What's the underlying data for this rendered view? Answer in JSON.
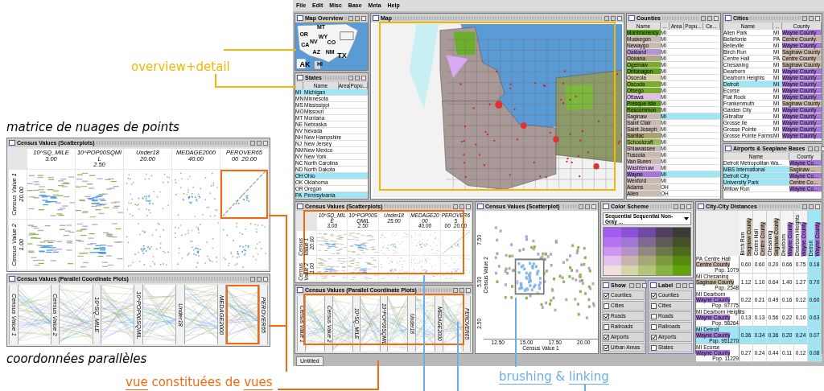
{
  "annotations": {
    "overview": {
      "text": "overview+detail",
      "color": "#f2b705"
    },
    "matrix_caption": "matrice de nuages de points",
    "parallel_caption": "coordonnées parallèles",
    "composite": {
      "color": "#f26a10",
      "parts": [
        {
          "text": "vue",
          "underlined": true
        },
        {
          "text": "constituées de",
          "underlined": false
        },
        {
          "text": "vues",
          "underlined": true
        }
      ]
    },
    "brushing": {
      "color": "#6aaee8",
      "parts": [
        {
          "text": "brushing",
          "underlined": true
        },
        {
          "text": "&",
          "underlined": false
        },
        {
          "text": "linking",
          "underlined": true
        }
      ]
    }
  },
  "zoomed_scatterplots": {
    "title": "Census Values (Scatterplots)",
    "columns": [
      {
        "label": "10^SQ_MILE",
        "ticks": [
          "3.00"
        ],
        "highlighted": false
      },
      {
        "label": "10^POP00SQMIL",
        "ticks": [
          "2.50"
        ],
        "highlighted": false
      },
      {
        "label": "Under18",
        "ticks": [
          "20.00"
        ],
        "highlighted": false
      },
      {
        "label": "MEDAGE2000",
        "ticks": [
          "40.00"
        ],
        "highlighted": false
      },
      {
        "label": "PEROVER65",
        "ticks": [
          "00",
          "20.00"
        ],
        "highlighted": true
      }
    ],
    "rows": [
      {
        "label": "Census Value 1",
        "tick": "20.00"
      },
      {
        "label": "Census Value 2",
        "tick": "1.00"
      }
    ]
  },
  "zoomed_parallel": {
    "title": "Census Values (Parallel Coordinate Plots)",
    "axes": [
      {
        "label": "Census Value 1",
        "highlighted": false
      },
      {
        "label": "Census Value 2",
        "highlighted": false
      },
      {
        "label": "10^SQ_MILE",
        "highlighted": false
      },
      {
        "label": "10^POP00SQMIL",
        "highlighted": false
      },
      {
        "label": "Under18",
        "highlighted": false
      },
      {
        "label": "MEDAGE2000",
        "highlighted": true
      },
      {
        "label": "PEROVER65",
        "highlighted": false
      }
    ]
  },
  "menu": [
    "File",
    "Edit",
    "Misc",
    "Base",
    "Meta",
    "Help"
  ],
  "map_overview": {
    "title": "Map Overview",
    "highlighted": true,
    "labels": [
      "MT",
      "OR",
      "WY",
      "CA",
      "NV",
      "CO",
      "AZ",
      "NM",
      "TX",
      "AK",
      "HI"
    ]
  },
  "states": {
    "title": "States",
    "columns": [
      "Name",
      "Area",
      "Popu..."
    ],
    "rows": [
      {
        "code": "MI",
        "name": "Michigan",
        "selected": true
      },
      {
        "code": "MN",
        "name": "Minnesota",
        "selected": false
      },
      {
        "code": "MS",
        "name": "Mississippi",
        "selected": false
      },
      {
        "code": "MO",
        "name": "Missouri",
        "selected": false
      },
      {
        "code": "MT",
        "name": "Montana",
        "selected": false
      },
      {
        "code": "NE",
        "name": "Nebraska",
        "selected": false
      },
      {
        "code": "NV",
        "name": "Nevada",
        "selected": false
      },
      {
        "code": "NH",
        "name": "New Hampshire",
        "selected": false
      },
      {
        "code": "NJ",
        "name": "New Jersey",
        "selected": false
      },
      {
        "code": "NM",
        "name": "New Mexico",
        "selected": false
      },
      {
        "code": "NY",
        "name": "New York",
        "selected": false
      },
      {
        "code": "NC",
        "name": "North Carolina",
        "selected": false
      },
      {
        "code": "ND",
        "name": "North Dakota",
        "selected": false
      },
      {
        "code": "OH",
        "name": "Ohio",
        "selected": true
      },
      {
        "code": "OK",
        "name": "Oklahoma",
        "selected": false
      },
      {
        "code": "OR",
        "name": "Oregon",
        "selected": false
      },
      {
        "code": "PA",
        "name": "Pennsylvania",
        "selected": true
      }
    ]
  },
  "map": {
    "title": "Map",
    "highlighted": true
  },
  "counties": {
    "title": "Counties",
    "columns": [
      "Name",
      "...",
      "Area",
      "Popu...",
      "Ce..."
    ],
    "rows": [
      {
        "name": "Montmorency",
        "state": "MI",
        "selected": false,
        "color": "#5f9e1e"
      },
      {
        "name": "Muskegon",
        "state": "MI",
        "selected": false,
        "color": "#c9bab2"
      },
      {
        "name": "Newaygo",
        "state": "MI",
        "selected": false,
        "color": "#c9bab2"
      },
      {
        "name": "Oakland",
        "state": "MI",
        "selected": false,
        "color": "#b592d6"
      },
      {
        "name": "Oceana",
        "state": "MI",
        "selected": false,
        "color": "#b0a68a"
      },
      {
        "name": "Ogemaw",
        "state": "MI",
        "selected": false,
        "color": "#7cac2c"
      },
      {
        "name": "Ontonagon",
        "state": "MI",
        "selected": false,
        "color": "#5f9e1e"
      },
      {
        "name": "Osceola",
        "state": "MI",
        "selected": false,
        "color": "#d9d2a8"
      },
      {
        "name": "Oscoda",
        "state": "MI",
        "selected": false,
        "color": "#7cac2c"
      },
      {
        "name": "Otsego",
        "state": "MI",
        "selected": false,
        "color": "#7cac2c"
      },
      {
        "name": "Ottawa",
        "state": "MI",
        "selected": false,
        "color": "#e3bdea"
      },
      {
        "name": "Presque Isle",
        "state": "MI",
        "selected": false,
        "color": "#5f9e1e"
      },
      {
        "name": "Roscommon",
        "state": "MI",
        "selected": false,
        "color": "#5f9e1e"
      },
      {
        "name": "Saginaw",
        "state": "MI",
        "selected": true,
        "color": "#c9bab2"
      },
      {
        "name": "Saint Clair",
        "state": "MI",
        "selected": false,
        "color": "#c9bab2"
      },
      {
        "name": "Saint Joseph",
        "state": "MI",
        "selected": false,
        "color": "#c9bab2"
      },
      {
        "name": "Sanilac",
        "state": "MI",
        "selected": false,
        "color": "#aaa272"
      },
      {
        "name": "Schoolcraft",
        "state": "MI",
        "selected": false,
        "color": "#9cba52"
      },
      {
        "name": "Shiawassee",
        "state": "MI",
        "selected": false,
        "color": "#c9bab2"
      },
      {
        "name": "Tuscola",
        "state": "MI",
        "selected": false,
        "color": "#c9bab2"
      },
      {
        "name": "Van Buren",
        "state": "MI",
        "selected": false,
        "color": "#c9bab2"
      },
      {
        "name": "Washtenaw",
        "state": "MI",
        "selected": false,
        "color": "#e3bdea"
      },
      {
        "name": "Wayne",
        "state": "MI",
        "selected": true,
        "color": "#a678d6"
      },
      {
        "name": "Wexford",
        "state": "MI",
        "selected": false,
        "color": "#c9bab2"
      },
      {
        "name": "Adams",
        "state": "OH",
        "selected": false,
        "color": "#c9bab2"
      },
      {
        "name": "Allen",
        "state": "OH",
        "selected": false,
        "color": "#c9bab2"
      }
    ]
  },
  "cities": {
    "title": "Cities",
    "columns": [
      "Name",
      "...",
      "County"
    ],
    "rows": [
      {
        "name": "Allen Park",
        "state": "MI",
        "county": "Wayne County",
        "color": "#a678d6",
        "selected": false
      },
      {
        "name": "Bellefonte",
        "state": "PA",
        "county": "Centre County",
        "color": "#c9b2aa",
        "selected": false
      },
      {
        "name": "Belleville",
        "state": "MI",
        "county": "Wayne County",
        "color": "#a678d6",
        "selected": false
      },
      {
        "name": "Birch Run",
        "state": "MI",
        "county": "Saginaw County",
        "color": "#c2b9a0",
        "selected": false
      },
      {
        "name": "Centre Hall",
        "state": "PA",
        "county": "Centre County",
        "color": "#c9b2aa",
        "selected": false
      },
      {
        "name": "Chesaning",
        "state": "MI",
        "county": "Saginaw County",
        "color": "#c2b9a0",
        "selected": false
      },
      {
        "name": "Dearborn",
        "state": "MI",
        "county": "Wayne County",
        "color": "#a678d6",
        "selected": false
      },
      {
        "name": "Dearborn Heights",
        "state": "MI",
        "county": "Wayne County",
        "color": "#a678d6",
        "selected": false
      },
      {
        "name": "Detroit",
        "state": "MI",
        "county": "Wayne County",
        "color": "#a678d6",
        "selected": true
      },
      {
        "name": "Ecorse",
        "state": "MI",
        "county": "Wayne County",
        "color": "#a678d6",
        "selected": false
      },
      {
        "name": "Flat Rock",
        "state": "MI",
        "county": "Wayne County",
        "color": "#a678d6",
        "selected": false
      },
      {
        "name": "Frankenmuth",
        "state": "MI",
        "county": "Saginaw County",
        "color": "#c2b9a0",
        "selected": false
      },
      {
        "name": "Garden City",
        "state": "MI",
        "county": "Wayne County",
        "color": "#a678d6",
        "selected": false
      },
      {
        "name": "Gibraltar",
        "state": "MI",
        "county": "Wayne County",
        "color": "#a678d6",
        "selected": false
      },
      {
        "name": "Grosse Ile",
        "state": "MI",
        "county": "Wayne County",
        "color": "#a678d6",
        "selected": false
      },
      {
        "name": "Grosse Pointe",
        "state": "MI",
        "county": "Wayne County",
        "color": "#a678d6",
        "selected": false
      },
      {
        "name": "Grosse Pointe Farms",
        "state": "MI",
        "county": "Wayne County",
        "color": "#a678d6",
        "selected": false
      }
    ]
  },
  "airports": {
    "title": "Airports & Seaplane Bases",
    "columns": [
      "Name",
      "County"
    ],
    "rows": [
      {
        "name": "Detroit Metropolitan Wa...",
        "county": "Wayne Co...",
        "color": "#a678d6",
        "selected": false
      },
      {
        "name": "MBS International",
        "county": "Saginaw ...",
        "color": "#c2b9a0",
        "selected": true
      },
      {
        "name": "Detroit City",
        "county": "Wayne Co...",
        "color": "#a678d6",
        "selected": true
      },
      {
        "name": "University Park",
        "county": "Centre Co...",
        "color": "#c9b2aa",
        "selected": true
      },
      {
        "name": "Willow Run",
        "county": "Wayne Co...",
        "color": "#a678d6",
        "selected": false
      }
    ]
  },
  "scatterplots": {
    "title": "Census Values (Scatterplots)",
    "highlighted": true,
    "columns": [
      {
        "label": "10^SQ_MILE",
        "ticks": [
          "3.00"
        ]
      },
      {
        "label": "10^POP00SQMIL",
        "ticks": [
          "2.50"
        ]
      },
      {
        "label": "Under18",
        "ticks": [
          "25.00"
        ]
      },
      {
        "label": "MEDAGE2000",
        "ticks": [
          "40.00"
        ]
      },
      {
        "label": "PEROVER65",
        "ticks": [
          "00",
          "20.00"
        ]
      }
    ],
    "rows": [
      {
        "label": "Census Value 1",
        "tick": "20.00"
      },
      {
        "label": "Census Value 2",
        "tick": "1.00"
      }
    ]
  },
  "parallel": {
    "title": "Census Values (Parallel Coordinate Plots)",
    "highlighted": true,
    "axes": [
      {
        "label": "Census Value 1"
      },
      {
        "label": "Census Value 2"
      },
      {
        "label": "10^SQ_MILE"
      },
      {
        "label": "10^POP00SQMIL"
      },
      {
        "label": "Under18"
      },
      {
        "label": "MEDAGE2000"
      },
      {
        "label": "PEROVER65"
      }
    ]
  },
  "scatterplot": {
    "title": "Census Values (Scatterplot)",
    "xlabel": "Census Value 1",
    "ylabel": "Census Value 2",
    "xticks": [
      "12.50",
      "15.00",
      "17.50",
      "20.00"
    ],
    "yticks": [
      "7.50",
      "5.00",
      "2.50"
    ]
  },
  "color_scheme": {
    "title": "Color Scheme",
    "selected_scheme": "Sequential Sequential Non-Gray ...",
    "swatches": [
      {
        "color": "#a55cf0"
      },
      {
        "color": "#8c52d6"
      },
      {
        "color": "#6e4aa6"
      },
      {
        "color": "#524060"
      },
      {
        "color": "#3e3a3a"
      },
      {
        "color": "#b474ef"
      },
      {
        "color": "#a07ad0"
      },
      {
        "color": "#806a90"
      },
      {
        "color": "#605a5a"
      },
      {
        "color": "#46502a"
      },
      {
        "color": "#cc98ee"
      },
      {
        "color": "#b690c8"
      },
      {
        "color": "#908a80"
      },
      {
        "color": "#6a7a46"
      },
      {
        "color": "#4c6a1e"
      },
      {
        "color": "#e2c2ea"
      },
      {
        "color": "#c6b6ae"
      },
      {
        "color": "#a6a878"
      },
      {
        "color": "#7e9a40"
      },
      {
        "color": "#568a0e"
      },
      {
        "color": "#f2e0dc"
      },
      {
        "color": "#d8d6a8"
      },
      {
        "color": "#b4c47a"
      },
      {
        "color": "#88b444"
      },
      {
        "color": "#5ea40a"
      }
    ]
  },
  "show": {
    "title": "Show",
    "items": [
      {
        "label": "Counties",
        "checked": true
      },
      {
        "label": "Cities",
        "checked": false
      },
      {
        "label": "Roads",
        "checked": true
      },
      {
        "label": "Railroads",
        "checked": false
      },
      {
        "label": "Airports",
        "checked": true
      },
      {
        "label": "Urban Areas",
        "checked": true
      }
    ]
  },
  "label": {
    "title": "Label",
    "items": [
      {
        "label": "Counties",
        "checked": true
      },
      {
        "label": "Cities",
        "checked": false
      },
      {
        "label": "Roads",
        "checked": false
      },
      {
        "label": "Railroads",
        "checked": false
      },
      {
        "label": "Airports",
        "checked": true
      },
      {
        "label": "States",
        "checked": false
      }
    ]
  },
  "distances": {
    "title": "City-City Distances",
    "columns": [
      {
        "city": "Birch Run",
        "county": "Saginaw County",
        "color": "#c2b9a0",
        "selected": false
      },
      {
        "city": "Centre Hall",
        "county": "Centre County",
        "color": "#c9b2aa",
        "selected": false
      },
      {
        "city": "Chesaning",
        "county": "Saginaw County",
        "color": "#c2b9a0",
        "selected": false
      },
      {
        "city": "Dearborn",
        "county": "Wayne County",
        "color": "#a678d6",
        "selected": false
      },
      {
        "city": "Dearborn Heights",
        "county": "Wayne County",
        "color": "#a678d6",
        "selected": false
      },
      {
        "city": "Detroit",
        "county": "Wayne County",
        "color": "#a678d6",
        "selected": true
      }
    ],
    "rows": [
      {
        "state": "PA",
        "city": "Centre Hall",
        "county": "Centre County",
        "pop": "Pop. 1079",
        "color": "#c9b2aa",
        "selected": false,
        "values": [
          "0.60",
          "0.60",
          "0.20",
          "0.66",
          "0.75",
          "0.18"
        ]
      },
      {
        "state": "MI",
        "city": "Chesaning",
        "county": "Saginaw County",
        "pop": "Pop. 2548",
        "color": "#c2b9a0",
        "selected": false,
        "values": [
          "1.12",
          "1.10",
          "0.64",
          "1.40",
          "1.27",
          "0.70"
        ]
      },
      {
        "state": "MI",
        "city": "Dearborn",
        "county": "Wayne County",
        "pop": "Pop. 97775",
        "color": "#a678d6",
        "selected": false,
        "values": [
          "0.22",
          "0.21",
          "0.49",
          "0.16",
          "0.12",
          "0.60"
        ]
      },
      {
        "state": "MI",
        "city": "Dearborn Heights",
        "county": "Wayne County",
        "pop": "Pop. 58264",
        "color": "#a678d6",
        "selected": false,
        "values": [
          "0.13",
          "0.13",
          "0.56",
          "0.22",
          "0.10",
          "0.63"
        ]
      },
      {
        "state": "MI",
        "city": "Detroit",
        "county": "Wayne County",
        "pop": "Pop. 951270",
        "color": "#a678d6",
        "selected": true,
        "values": [
          "0.36",
          "0.34",
          "0.36",
          "0.20",
          "0.24",
          "0.07"
        ]
      },
      {
        "state": "MI",
        "city": "Ecorse",
        "county": "Wayne County",
        "pop": "Pop. 11229",
        "color": "#a678d6",
        "selected": false,
        "values": [
          "0.27",
          "0.24",
          "0.44",
          "0.11",
          "0.12",
          "0.08"
        ]
      }
    ]
  },
  "tabs": [
    {
      "label": "Untitled",
      "selected": true
    }
  ]
}
